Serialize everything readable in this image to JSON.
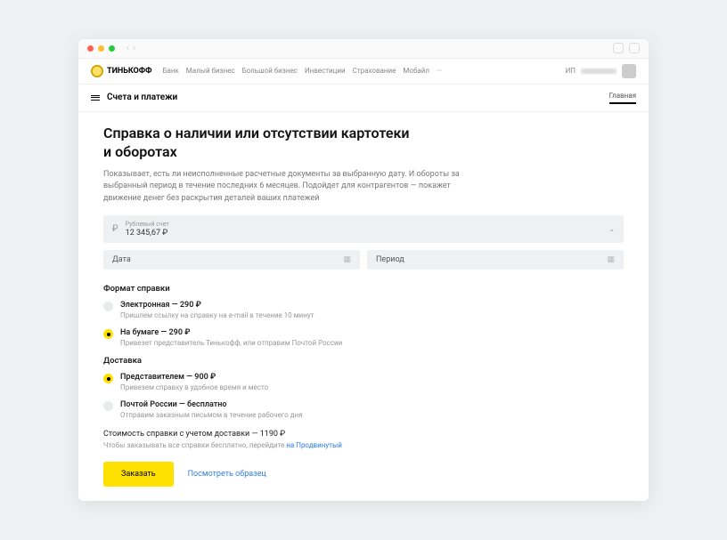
{
  "brand": "ТИНЬКОФФ",
  "nav": [
    "Банк",
    "Малый бизнес",
    "Большой бизнес",
    "Инвестиции",
    "Страхование",
    "Мобайл",
    "···"
  ],
  "account_prefix": "ИП",
  "subheader": {
    "title": "Счета и платежи",
    "tab": "Главная"
  },
  "page": {
    "title_line1": "Справка о наличии или отсутствии картотеки",
    "title_line2": "и оборотах",
    "lead": "Показывает, есть ли неисполненные расчетные документы за выбранную дату. И обороты за выбранный период в течение последних 6 месяцев. Подойдет для контрагентов — покажет движение денег без раскрытия деталей ваших платежей"
  },
  "account_field": {
    "label": "Рублевый счет",
    "value": "12 345,67 ₽"
  },
  "date_field": "Дата",
  "period_field": "Период",
  "format": {
    "heading": "Формат справки",
    "options": [
      {
        "title": "Электронная — 290 ₽",
        "desc": "Пришлем ссылку на справку на e-mail в течение 10 минут",
        "selected": false
      },
      {
        "title": "На бумаге — 290 ₽",
        "desc": "Привезет представитель Тинькофф, или отправим Почтой России",
        "selected": true
      }
    ]
  },
  "delivery": {
    "heading": "Доставка",
    "options": [
      {
        "title": "Представителем — 900 ₽",
        "desc": "Привезем справку в удобное время и место",
        "selected": true
      },
      {
        "title": "Почтой России — бесплатно",
        "desc": "Отправим заказным письмом в течение рабочего дня",
        "selected": false
      }
    ]
  },
  "total": "Стоимость справки с учетом доставки — 1190 ₽",
  "hint_prefix": "Чтобы заказывать все справки бесплатно, перейдите ",
  "hint_link": "на Продвинутый",
  "actions": {
    "order": "Заказать",
    "sample": "Посмотреть образец"
  }
}
